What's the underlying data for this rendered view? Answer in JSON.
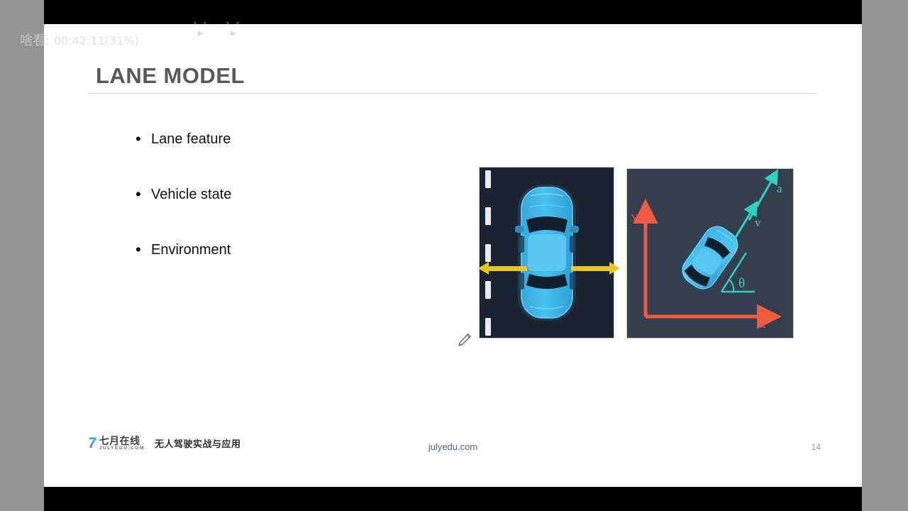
{
  "player": {
    "overlay_text_main": "啥看:",
    "overlay_text_time": "00:42:11(31%)",
    "watermark": "bilibili-logo"
  },
  "slide": {
    "title": "LANE MODEL",
    "bullets": [
      {
        "marker": "•",
        "label": "Lane feature"
      },
      {
        "marker": "•",
        "label": "Vehicle state"
      },
      {
        "marker": "•",
        "label": "Environment"
      }
    ],
    "figures": {
      "lane": {
        "name": "lane-position-figure",
        "description": "top-down blue car between lane markings with lateral offset arrows",
        "colors": {
          "background": "#1a2433",
          "car": "#39b7ea",
          "arrow": "#e8c520",
          "lane_mark": "#e9ecef"
        }
      },
      "state": {
        "name": "vehicle-state-figure",
        "description": "vehicle with velocity and acceleration vectors in an XY frame",
        "colors": {
          "background": "#353f4d",
          "axis": "#ef5b40",
          "vector": "#2fd2c0",
          "car": "#39b7ea"
        },
        "labels": {
          "axis_x": "x",
          "axis_y": "Y",
          "vector_v": "v",
          "vector_a": "a",
          "angle": "θ"
        }
      }
    },
    "footer": {
      "logo_mark": "7",
      "logo_cn": "七月在线",
      "logo_en": "JULYEDU.COM",
      "course": "无人驾驶实战与应用",
      "site": "julyedu.com",
      "page_number": "14"
    }
  },
  "toolbar": {
    "items": [
      {
        "name": "previous-slide-button",
        "icon": "arrow-left-icon",
        "active": false
      },
      {
        "name": "pen-tool-button",
        "icon": "pencil-icon",
        "active": false
      },
      {
        "name": "notes-button",
        "icon": "slide-notes-icon",
        "active": true
      },
      {
        "name": "next-slide-button",
        "icon": "arrow-right-icon",
        "active": false
      }
    ]
  },
  "cursor": {
    "icon": "pencil-cursor-icon"
  }
}
